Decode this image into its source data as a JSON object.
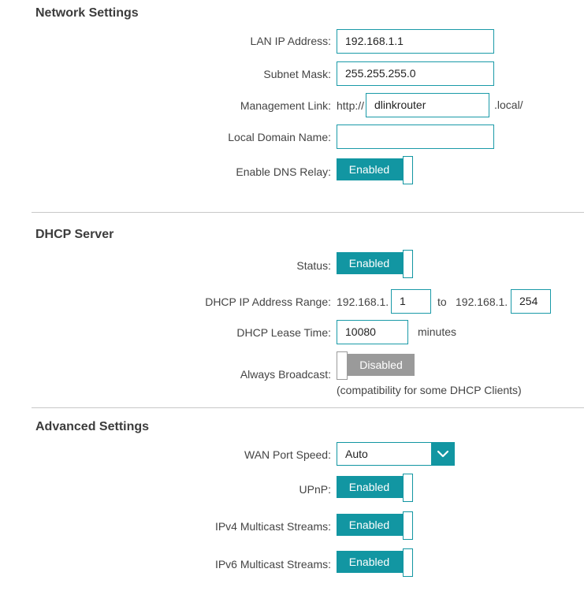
{
  "network": {
    "heading": "Network Settings",
    "lan_ip_label": "LAN IP Address:",
    "lan_ip_value": "192.168.1.1",
    "subnet_label": "Subnet Mask:",
    "subnet_value": "255.255.255.0",
    "mgmt_label": "Management Link:",
    "mgmt_prefix": "http://",
    "mgmt_value": "dlinkrouter",
    "mgmt_suffix": ".local/",
    "domain_label": "Local Domain Name:",
    "domain_value": "",
    "dns_relay_label": "Enable DNS Relay:",
    "dns_relay_state": "Enabled"
  },
  "dhcp": {
    "heading": "DHCP Server",
    "status_label": "Status:",
    "status_state": "Enabled",
    "range_label": "DHCP IP Address Range:",
    "range_prefix_start": "192.168.1.",
    "range_start": "1",
    "range_to": "to",
    "range_prefix_end": "192.168.1.",
    "range_end": "254",
    "lease_label": "DHCP Lease Time:",
    "lease_value": "10080",
    "lease_unit": "minutes",
    "broadcast_label": "Always Broadcast:",
    "broadcast_state": "Disabled",
    "broadcast_note": "(compatibility for some DHCP Clients)"
  },
  "advanced": {
    "heading": "Advanced Settings",
    "wan_speed_label": "WAN Port Speed:",
    "wan_speed_value": "Auto",
    "upnp_label": "UPnP:",
    "upnp_state": "Enabled",
    "ipv4_mc_label": "IPv4 Multicast Streams:",
    "ipv4_mc_state": "Enabled",
    "ipv6_mc_label": "IPv6 Multicast Streams:",
    "ipv6_mc_state": "Enabled"
  },
  "colors": {
    "accent": "#1296a2",
    "disabled": "#9a9a9a",
    "divider": "#c8c8c8"
  },
  "icons": {
    "dropdown": "chevron-down-icon"
  }
}
